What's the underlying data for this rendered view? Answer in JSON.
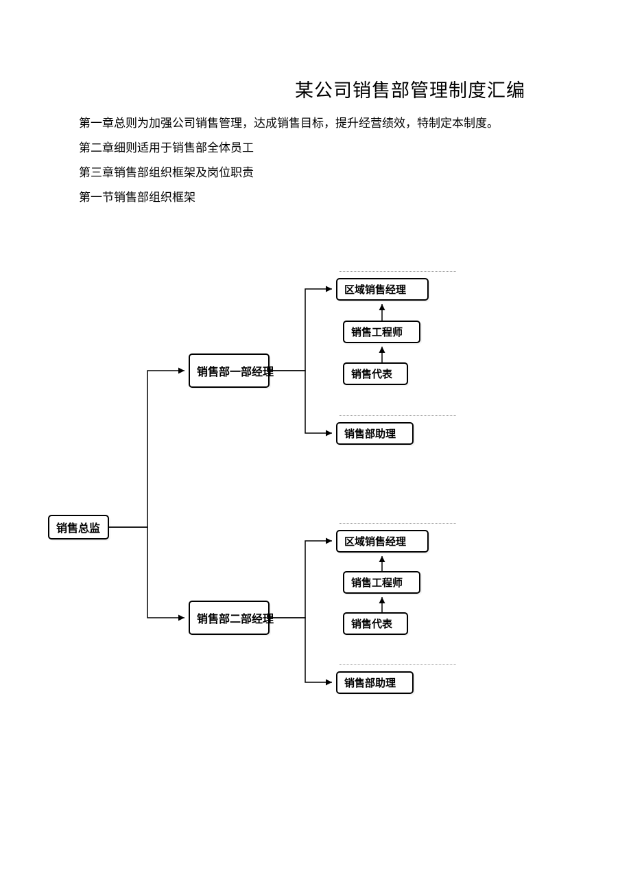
{
  "title": "某公司销售部管理制度汇编",
  "paragraphs": {
    "p1": "第一章总则为加强公司销售管理，达成销售目标，提升经营绩效，特制定本制度。",
    "p2": "第二章细则适用于销售部全体员工",
    "p3": "第三章销售部组织框架及岗位职责",
    "p4": "第一节销售部组织框架"
  },
  "org": {
    "root": "销售总监",
    "dept1": {
      "name": "销售部一部经理"
    },
    "dept2": {
      "name": "销售部二部经理"
    },
    "roles": {
      "regional": "区域销售经理",
      "engineer": "销售工程师",
      "rep": "销售代表",
      "assistant": "销售部助理"
    }
  }
}
